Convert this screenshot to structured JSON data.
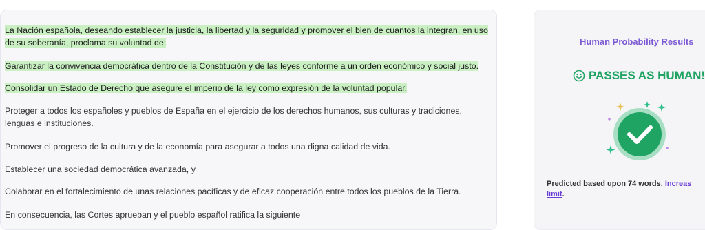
{
  "document": {
    "paragraphs": [
      {
        "text": "La Nación española, deseando establecer la justicia, la libertad y la seguridad y promover el bien de cuantos la integran, en uso de su soberanía, proclama su voluntad de:",
        "highlighted": true
      },
      {
        "text": "Garantizar la convivencia democrática dentro de la Constitución y de las leyes conforme a un orden económico y social justo.",
        "highlighted": true
      },
      {
        "text": "Consolidar un Estado de Derecho que asegure el imperio de la ley como expresión de la voluntad popular.",
        "highlighted": true
      },
      {
        "text": "Proteger a todos los españoles y pueblos de España en el ejercicio de los derechos humanos, sus culturas y tradiciones, lenguas e instituciones.",
        "highlighted": false
      },
      {
        "text": "Promover el progreso de la cultura y de la economía para asegurar a todos una digna calidad de vida.",
        "highlighted": false
      },
      {
        "text": "Establecer una sociedad democrática avanzada, y",
        "highlighted": false
      },
      {
        "text": "Colaborar en el fortalecimiento de unas relaciones pacíficas y de eficaz cooperación entre todos los pueblos de la Tierra.",
        "highlighted": false
      },
      {
        "text": "En consecuencia, las Cortes aprueban y el pueblo español ratifica la siguiente",
        "highlighted": false
      }
    ],
    "highlight_color": "#c9efc3"
  },
  "results": {
    "title": "Human Probability Results",
    "verdict": "PASSES AS HUMAN!",
    "verdict_icon": "smile-icon",
    "badge_icon": "check-badge-icon",
    "predicted_prefix": "Predicted based upon",
    "word_count": "74",
    "words_label": "words.",
    "limit_link_line1": "Increas",
    "limit_link_line2": "limit",
    "limit_link_suffix": ".",
    "colors": {
      "title": "#7c5ad4",
      "verdict": "#1fa463",
      "badge": "#1fa463",
      "link": "#6a3fd6"
    }
  }
}
